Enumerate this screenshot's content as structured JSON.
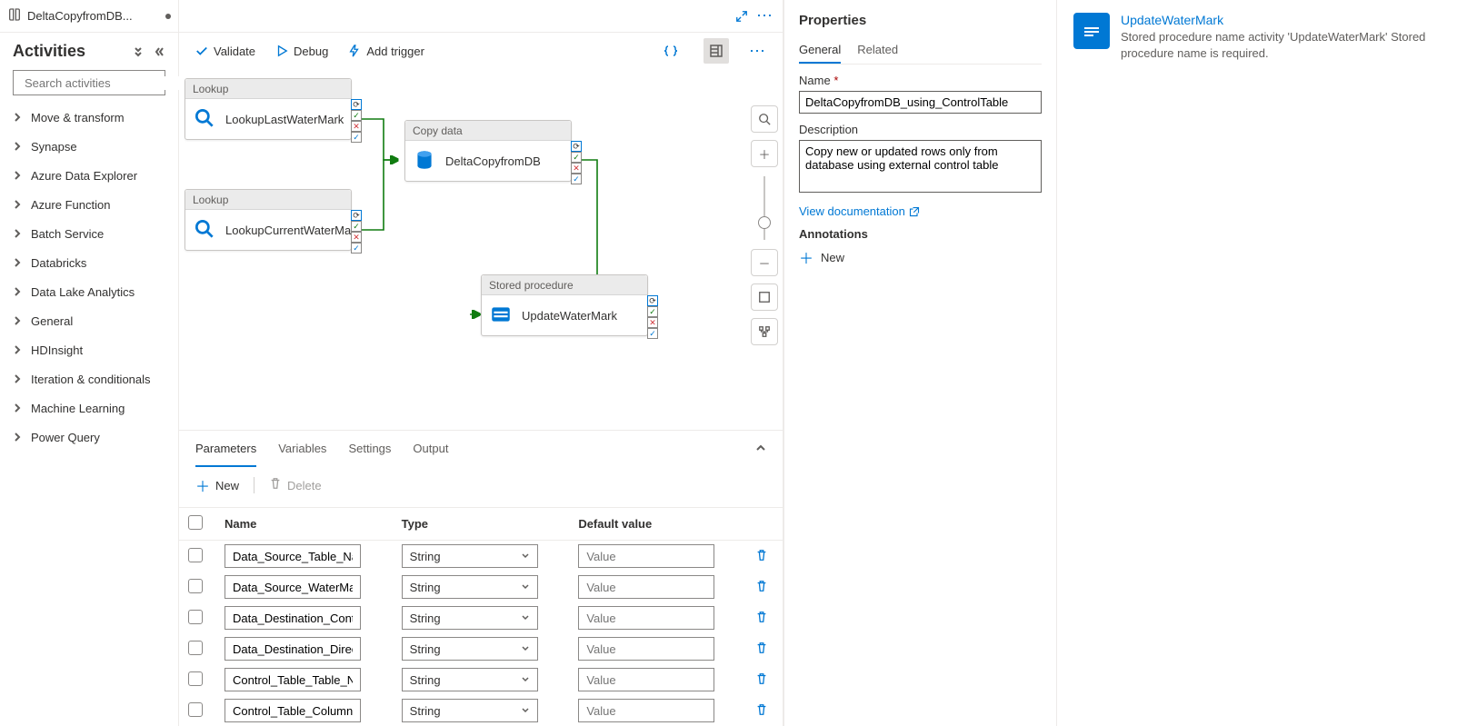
{
  "tab": {
    "title": "DeltaCopyfromDB..."
  },
  "sidebar": {
    "title": "Activities",
    "search_placeholder": "Search activities",
    "categories": [
      "Move & transform",
      "Synapse",
      "Azure Data Explorer",
      "Azure Function",
      "Batch Service",
      "Databricks",
      "Data Lake Analytics",
      "General",
      "HDInsight",
      "Iteration & conditionals",
      "Machine Learning",
      "Power Query"
    ]
  },
  "toolbar": {
    "validate": "Validate",
    "debug": "Debug",
    "add_trigger": "Add trigger"
  },
  "nodes": {
    "lookup1": {
      "type": "Lookup",
      "name": "LookupLastWaterMark"
    },
    "lookup2": {
      "type": "Lookup",
      "name": "LookupCurrentWaterMark"
    },
    "copy": {
      "type": "Copy data",
      "name": "DeltaCopyfromDB"
    },
    "sproc": {
      "type": "Stored procedure",
      "name": "UpdateWaterMark"
    }
  },
  "bottom": {
    "tabs": [
      "Parameters",
      "Variables",
      "Settings",
      "Output"
    ],
    "new": "New",
    "delete": "Delete",
    "headers": {
      "name": "Name",
      "type": "Type",
      "default": "Default value"
    },
    "rows": [
      {
        "name": "Data_Source_Table_Name",
        "type": "String",
        "default": "Value"
      },
      {
        "name": "Data_Source_WaterMarkColumn",
        "type": "String",
        "default": "Value"
      },
      {
        "name": "Data_Destination_Container",
        "type": "String",
        "default": "Value"
      },
      {
        "name": "Data_Destination_Directory",
        "type": "String",
        "default": "Value"
      },
      {
        "name": "Control_Table_Table_Name",
        "type": "String",
        "default": "Value"
      },
      {
        "name": "Control_Table_Column_Name",
        "type": "String",
        "default": "Value"
      }
    ]
  },
  "props": {
    "title": "Properties",
    "tabs": [
      "General",
      "Related"
    ],
    "name_label": "Name",
    "name_value": "DeltaCopyfromDB_using_ControlTable",
    "desc_label": "Description",
    "desc_value": "Copy new or updated rows only from database using external control table",
    "doc_link": "View documentation",
    "annotations_label": "Annotations",
    "new": "New"
  },
  "error": {
    "title": "UpdateWaterMark",
    "text": "Stored procedure name activity 'UpdateWaterMark' Stored procedure name is required."
  }
}
